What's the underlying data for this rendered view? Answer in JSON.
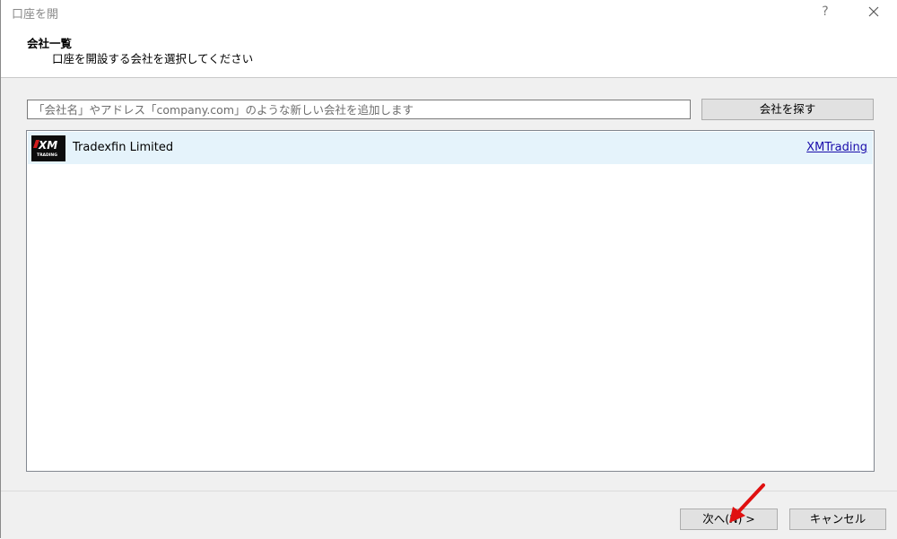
{
  "window": {
    "title": "口座を開",
    "help_glyph": "?"
  },
  "header": {
    "title": "会社一覧",
    "subtitle": "口座を開設する会社を選択してください"
  },
  "search": {
    "placeholder": "「会社名」やアドレス「company.com」のような新しい会社を追加します",
    "value": "",
    "find_button_label": "会社を探す"
  },
  "companies": [
    {
      "logo_icon": "xm-trading-logo",
      "name": "Tradexfin Limited",
      "link": "XMTrading"
    }
  ],
  "footer": {
    "next_label": "次へ(N) >",
    "cancel_label": "キャンセル"
  },
  "colors": {
    "selected_row": "#e5f3fb",
    "link": "#1a0dab",
    "annotation_arrow": "#e01010"
  }
}
